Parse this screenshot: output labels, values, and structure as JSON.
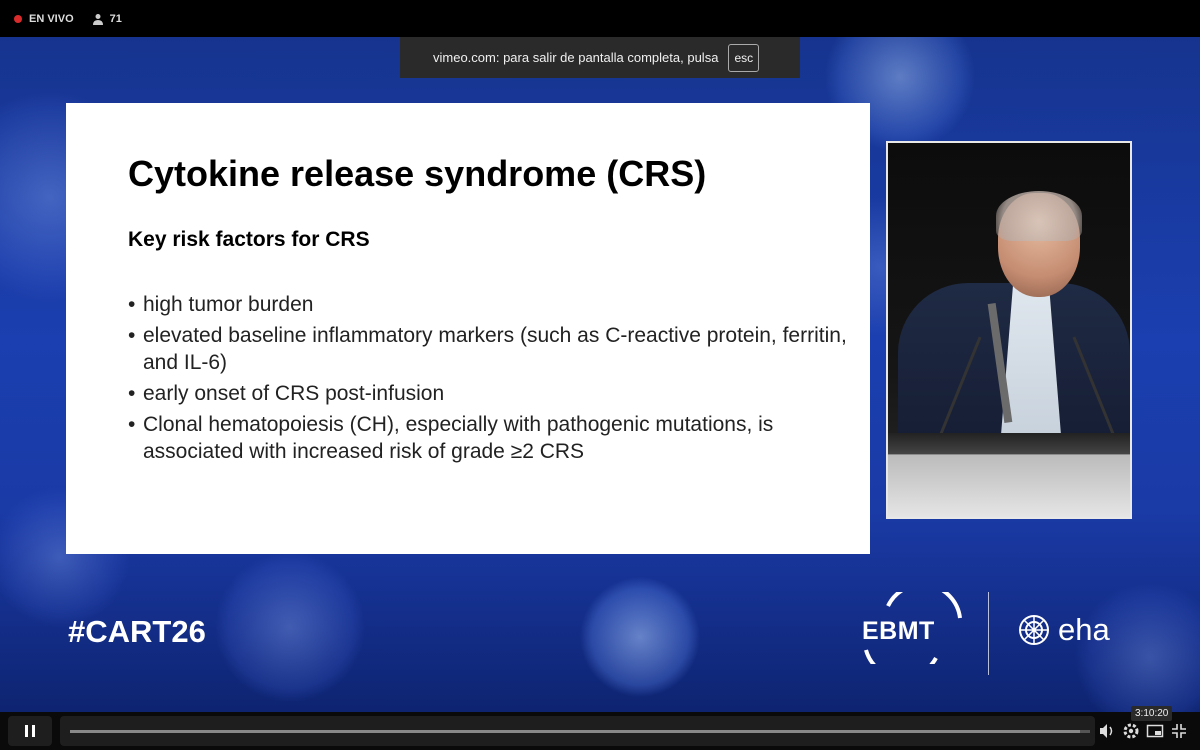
{
  "live_bar": {
    "live_label": "EN VIVO",
    "viewers": "71"
  },
  "fullscreen_tooltip": {
    "message": "vimeo.com: para salir de pantalla completa, pulsa",
    "key": "esc"
  },
  "slide": {
    "title": "Cytokine release syndrome (CRS)",
    "subtitle": "Key risk factors for CRS",
    "bullets": [
      "high tumor burden",
      "elevated baseline inflammatory markers (such as C-reactive protein, ferritin, and IL-6)",
      "early onset of CRS post-infusion",
      "Clonal hematopoiesis (CH), especially with pathogenic mutations, is associated with increased risk of grade ≥2 CRS"
    ]
  },
  "event": {
    "hashtag": "#CART26",
    "logo_ebmt": "EBMT",
    "logo_eha": "eha"
  },
  "player": {
    "time": "3:10:20",
    "progress": 0.99,
    "icons": [
      "pause-icon",
      "volume-icon",
      "settings-icon",
      "pip-icon",
      "exit-fullscreen-icon"
    ]
  },
  "colors": {
    "live": "#d92b2b",
    "background_blue": "#1b3fb0",
    "slide_bg": "#ffffff"
  }
}
